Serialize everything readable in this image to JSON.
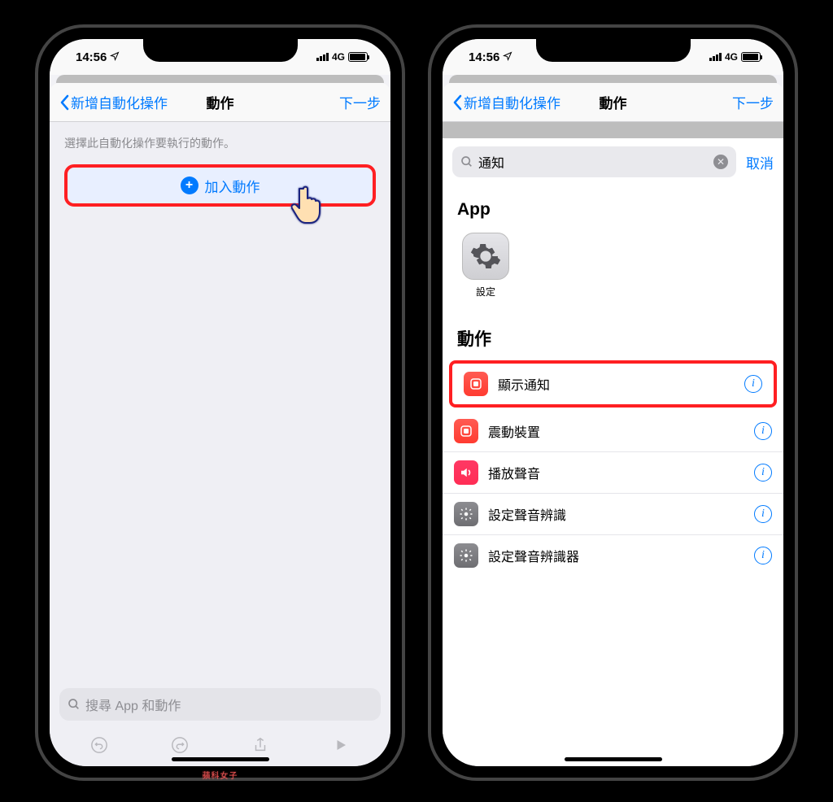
{
  "status": {
    "time": "14:56",
    "network_label": "4G"
  },
  "phone1": {
    "nav": {
      "back": "新增自動化操作",
      "title": "動作",
      "next": "下一步"
    },
    "caption": "選擇此自動化操作要執行的動作。",
    "add_action": "加入動作",
    "search_placeholder": "搜尋 App 和動作"
  },
  "phone2": {
    "nav": {
      "back": "新增自動化操作",
      "title": "動作",
      "next": "下一步"
    },
    "search": {
      "query": "通知",
      "cancel": "取消"
    },
    "section_app": "App",
    "apps": [
      {
        "name": "設定"
      }
    ],
    "section_actions": "動作",
    "actions": [
      {
        "title": "顯示通知",
        "icon": "shortcut",
        "color": "red",
        "highlighted": true
      },
      {
        "title": "震動裝置",
        "icon": "shortcut",
        "color": "red"
      },
      {
        "title": "播放聲音",
        "icon": "sound",
        "color": "pink"
      },
      {
        "title": "設定聲音辨識",
        "icon": "settings",
        "color": "gray"
      },
      {
        "title": "設定聲音辨識器",
        "icon": "settings",
        "color": "gray"
      }
    ]
  },
  "watermark": "蘋科女子"
}
